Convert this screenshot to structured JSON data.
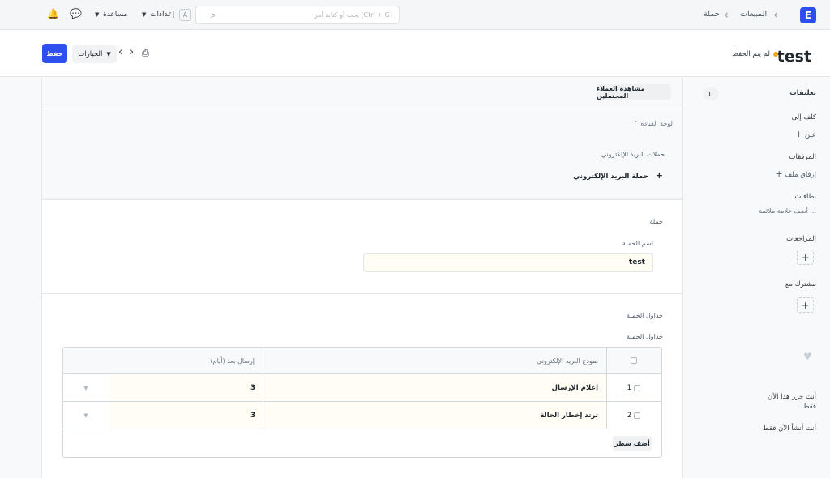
{
  "navbar": {
    "logo_letter": "E",
    "breadcrumbs": [
      "المبيعات",
      "حملة"
    ],
    "search_placeholder": "بحث أو كتابة أمر (Ctrl + G)",
    "kbd_hint": "A",
    "settings_label": "إعدادات",
    "help_label": "مساعدة"
  },
  "page": {
    "title": "test",
    "unsaved_label": "لم يتم الحفظ",
    "save_label": "حفظ",
    "actions_label": "الخيارات"
  },
  "main": {
    "view_leads_button": "مشاهدة العملاء المحتملين",
    "dashboard_label": "لوحة القيادة",
    "email_campaigns_label": "حملات البريد الإلكتروني",
    "new_email_campaign_button": "حملة البريد الإلكتروني",
    "campaign_section_title": "حملة",
    "campaign_name_label": "اسم الحملة",
    "campaign_name_value": "test",
    "schedules_section_title": "جداول الحملة",
    "schedules_field_label": "جداول الحملة",
    "table": {
      "columns": [
        "نموذج البريد الإلكتروني",
        "إرسال بعد (أيام)"
      ],
      "rows": [
        {
          "idx": "1",
          "template": "إعلام الإرسال",
          "days": "3"
        },
        {
          "idx": "2",
          "template": "ترتد إخطار الحالة",
          "days": "3"
        }
      ],
      "add_row_button": "أضف سطر"
    }
  },
  "sidebar": {
    "comments_label": "تعليقات",
    "comments_count": "0",
    "assigned_to_label": "كلف إلى",
    "assign_label": "عين",
    "attachments_label": "المرفقات",
    "attach_file_label": "إرفاق ملف",
    "tags_label": "بطاقات",
    "add_tag_label": "أضف علامة ملائمة ...",
    "reviews_label": "المراجعات",
    "shared_with_label": "مشترك مع",
    "edited_by_label": "أنت حرر هذا الآن فقط",
    "created_by_label": "أنت أنشأ الآن فقط"
  },
  "colors": {
    "primary": "#2e4ff0",
    "unsaved_dot": "#f5a623",
    "input_bg": "#fffdf4"
  }
}
